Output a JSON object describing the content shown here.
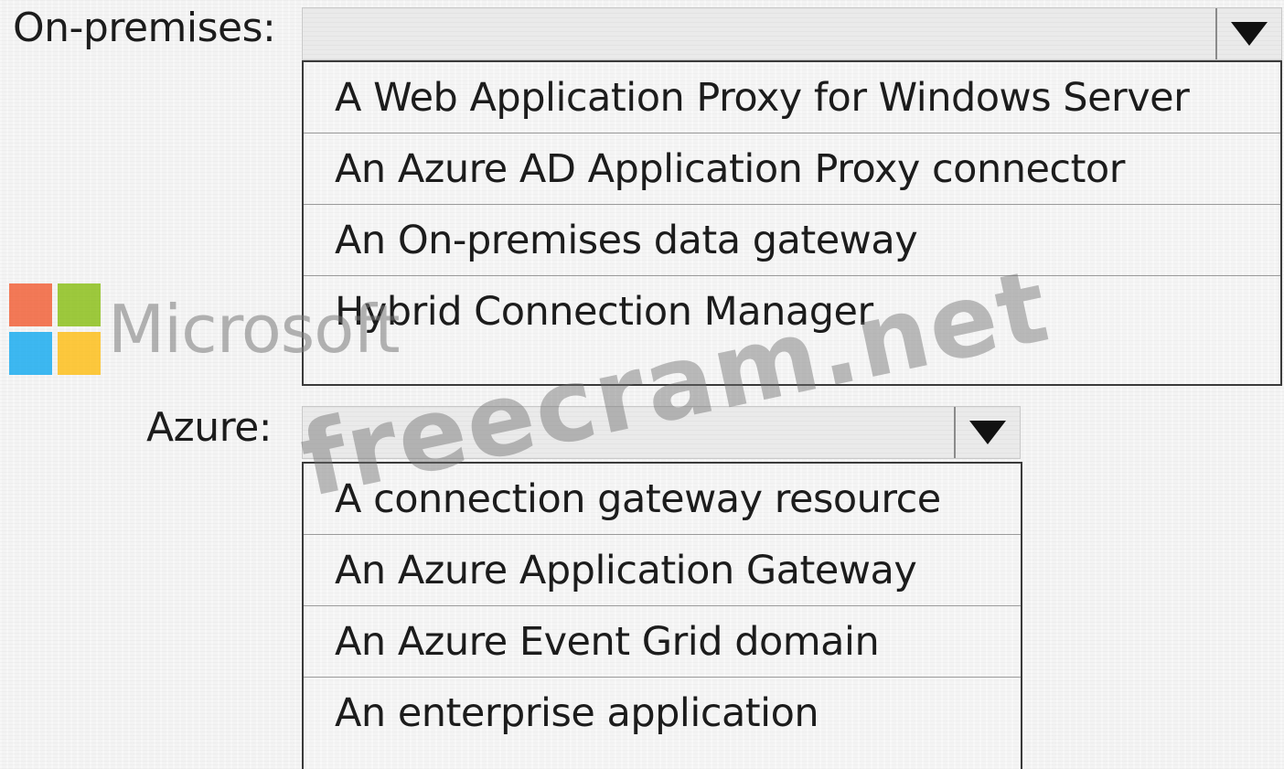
{
  "onpremises": {
    "label": "On-premises:",
    "selected_value": "",
    "options": [
      "A Web Application Proxy for Windows Server",
      "An Azure AD Application Proxy connector",
      "An On-premises data gateway",
      "Hybrid Connection Manager"
    ]
  },
  "azure": {
    "label": "Azure:",
    "selected_value": "",
    "options": [
      "A connection gateway resource",
      "An Azure Application Gateway",
      "An Azure Event Grid domain",
      "An enterprise application"
    ]
  },
  "watermark": {
    "logo_text": "Microsoft",
    "site_text": "freecram.net",
    "logo_colors": [
      "#f25022",
      "#7fba00",
      "#00a4ef",
      "#ffb900"
    ]
  },
  "icons": {
    "dropdown_arrow": "triangle-down-icon"
  }
}
